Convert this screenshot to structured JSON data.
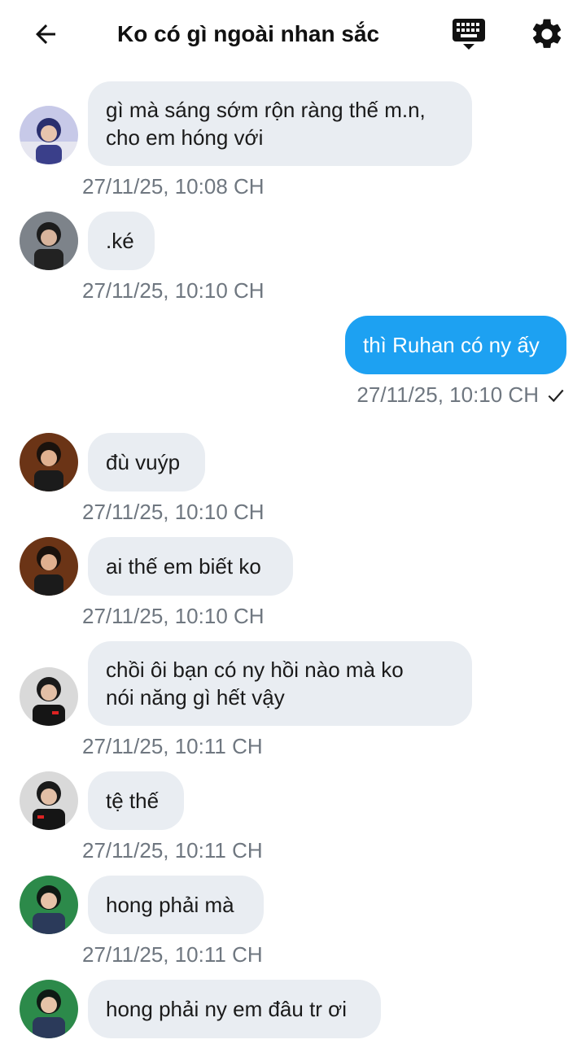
{
  "header": {
    "title": "Ko có gì ngoài nhan sắc",
    "back_icon": "arrow-left-icon",
    "keyboard_icon": "keyboard-icon",
    "settings_icon": "gear-icon"
  },
  "colors": {
    "incoming_bubble": "#e9edf2",
    "outgoing_bubble": "#1da1f2",
    "timestamp": "#6f7780"
  },
  "messages": [
    {
      "direction": "in",
      "lines": [
        "gì mà sáng sớm rộn ràng thế m.n,",
        "cho em hóng với"
      ],
      "time": "27/11/25, 10:08 CH"
    },
    {
      "direction": "in",
      "lines": [
        ".ké"
      ],
      "time": "27/11/25, 10:10 CH"
    },
    {
      "direction": "out",
      "lines": [
        "thì Ruhan có ny ấy"
      ],
      "time": "27/11/25, 10:10 CH",
      "status": "✓"
    },
    {
      "direction": "in",
      "lines": [
        "đù vuýp"
      ],
      "time": "27/11/25, 10:10 CH"
    },
    {
      "direction": "in",
      "lines": [
        "ai thế em biết ko"
      ],
      "time": "27/11/25, 10:10 CH"
    },
    {
      "direction": "in",
      "lines": [
        "chồi ôi bạn có ny hồi nào mà ko",
        "nói năng gì hết vậy"
      ],
      "time": "27/11/25, 10:11 CH"
    },
    {
      "direction": "in",
      "lines": [
        "tệ thế"
      ],
      "time": "27/11/25, 10:11 CH"
    },
    {
      "direction": "in",
      "lines": [
        "hong phải mà"
      ],
      "time": "27/11/25, 10:11 CH"
    },
    {
      "direction": "in",
      "lines": [
        "hong phải ny em đâu tr ơi"
      ]
    }
  ]
}
